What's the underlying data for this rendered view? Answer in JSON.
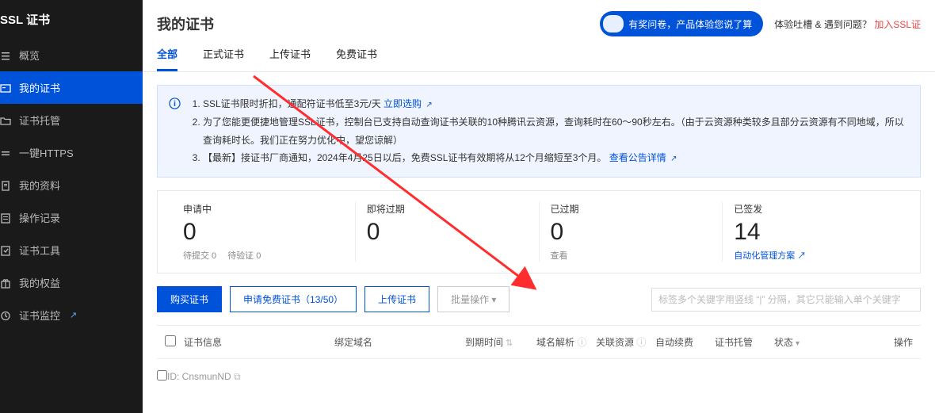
{
  "app_title": "SSL 证书",
  "sidebar": [
    {
      "icon": "list",
      "label": "概览"
    },
    {
      "icon": "card",
      "label": "我的证书",
      "active": true
    },
    {
      "icon": "folder",
      "label": "证书托管"
    },
    {
      "icon": "equals",
      "label": "一键HTTPS"
    },
    {
      "icon": "doc",
      "label": "我的资料"
    },
    {
      "icon": "clock",
      "label": "操作记录"
    },
    {
      "icon": "tool",
      "label": "证书工具"
    },
    {
      "icon": "gift",
      "label": "我的权益"
    },
    {
      "icon": "monitor",
      "label": "证书监控",
      "ext": true
    }
  ],
  "page_title": "我的证书",
  "promo": "有奖问卷，产品体验您说了算",
  "help_prefix": "体验吐槽 & 遇到问题？",
  "help_link": "加入SSL证",
  "tabs": [
    "全部",
    "正式证书",
    "上传证书",
    "免费证书"
  ],
  "active_tab": 0,
  "notice": {
    "item1_pre": "SSL证书限时折扣，通配符证书低至3元/天 ",
    "item1_link": "立即选购",
    "item2": "为了您能更便捷地管理SSL证书，控制台已支持自动查询证书关联的10种腾讯云资源，查询耗时在60～90秒左右。（由于云资源种类较多且部分云资源有不同地域，所以查询耗时长。我们正在努力优化中，望您谅解）",
    "item3_pre": "【最新】接证书厂商通知，2024年4月25日以后，免费SSL证书有效期将从12个月缩短至3个月。",
    "item3_link": "查看公告详情"
  },
  "stats": [
    {
      "label": "申请中",
      "value": "0",
      "sub": [
        {
          "t": "待提交 0"
        },
        {
          "t": "待验证 0"
        }
      ]
    },
    {
      "label": "即将过期",
      "value": "0",
      "sub": []
    },
    {
      "label": "已过期",
      "value": "0",
      "sub": [
        {
          "t": "查看"
        }
      ]
    },
    {
      "label": "已签发",
      "value": "14",
      "sub": [
        {
          "t": "自动化管理方案 ↗",
          "link": true
        }
      ]
    }
  ],
  "buttons": {
    "buy": "购买证书",
    "free": "申请免费证书（13/50）",
    "upload": "上传证书",
    "batch": "批量操作 ▾"
  },
  "search_placeholder": "标签多个关键字用竖线 “|” 分隔，其它只能输入单个关键字",
  "columns": {
    "info": "证书信息",
    "domain": "绑定域名",
    "expire": "到期时间",
    "dns": "域名解析",
    "res": "关联资源",
    "renew": "自动续费",
    "host": "证书托管",
    "status": "状态",
    "op": "操作"
  },
  "row0_id": "CnsmunND"
}
